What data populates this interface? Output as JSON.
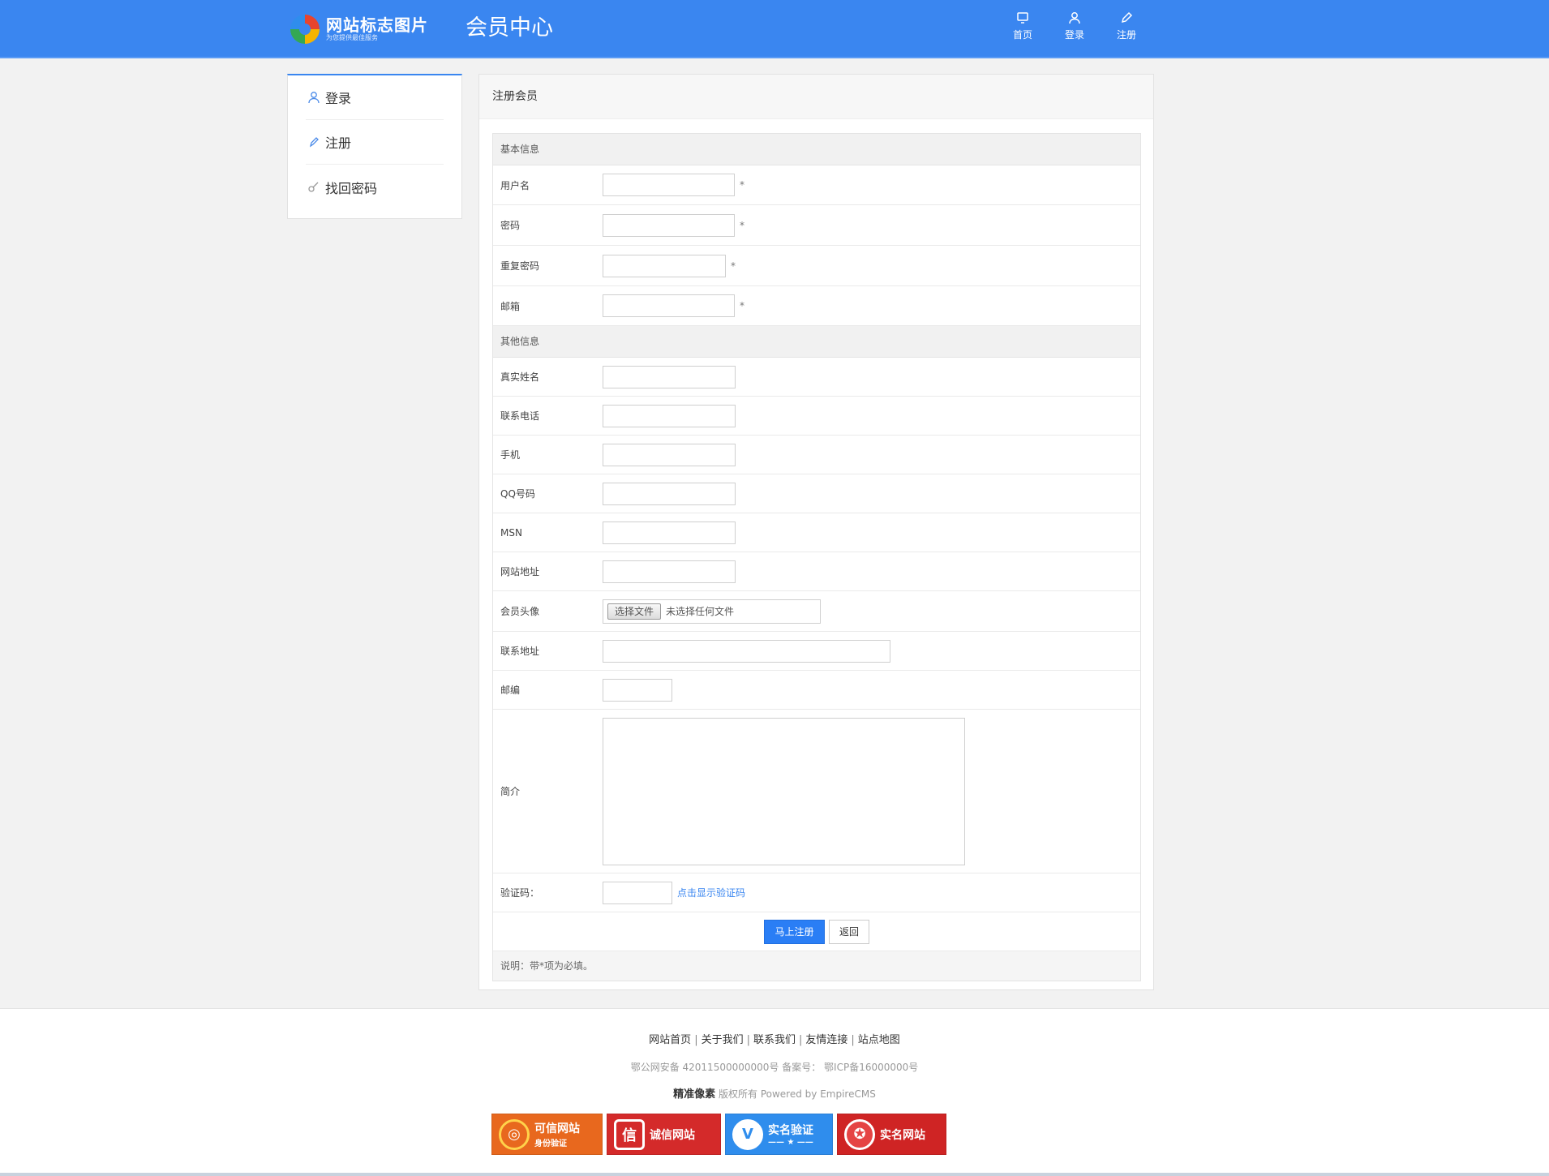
{
  "header": {
    "logo_main": "网站标志图片",
    "logo_sub": "为您提供最佳服务",
    "title": "会员中心",
    "nav": [
      {
        "label": "首页",
        "icon": "monitor-icon"
      },
      {
        "label": "登录",
        "icon": "user-icon"
      },
      {
        "label": "注册",
        "icon": "pencil-icon"
      }
    ]
  },
  "sidebar": {
    "items": [
      {
        "label": "登录",
        "icon": "user-icon"
      },
      {
        "label": "注册",
        "icon": "pencil-icon"
      },
      {
        "label": "找回密码",
        "icon": "key-icon"
      }
    ]
  },
  "panel": {
    "title": "注册会员",
    "basic_section": "基本信息",
    "other_section": "其他信息",
    "basic_fields": [
      {
        "label": "用户名",
        "required": "*"
      },
      {
        "label": "密码",
        "required": "*"
      },
      {
        "label": "重复密码",
        "required": "*"
      },
      {
        "label": "邮箱",
        "required": "*"
      }
    ],
    "other_fields": [
      {
        "label": "真实姓名"
      },
      {
        "label": "联系电话"
      },
      {
        "label": "手机"
      },
      {
        "label": "QQ号码"
      },
      {
        "label": "MSN"
      },
      {
        "label": "网站地址"
      }
    ],
    "avatar_label": "会员头像",
    "file_button": "选择文件",
    "file_status": "未选择任何文件",
    "address_label": "联系地址",
    "zip_label": "邮编",
    "intro_label": "简介",
    "captcha_label": "验证码：",
    "captcha_link": "点击显示验证码",
    "submit_button": "马上注册",
    "back_button": "返回",
    "note": "说明：带*项为必填。"
  },
  "footer": {
    "links": [
      "网站首页",
      "关于我们",
      "联系我们",
      "友情连接",
      "站点地图"
    ],
    "separator": "|",
    "icp": "鄂公网安备 42011500000000号 备案号： 鄂ICP备16000000号",
    "brand": "精准像素",
    "copyright": "版权所有 Powered by EmpireCMS",
    "badges": [
      {
        "label": "可信网站",
        "sub": "身份验证",
        "color": "#e8681e"
      },
      {
        "label": "诚信网站",
        "sub": "",
        "color": "#d42a2a"
      },
      {
        "label": "实名验证",
        "sub": "—— ★ ——",
        "color": "#2f8ded"
      },
      {
        "label": "实名网站",
        "sub": "",
        "color": "#cf2424"
      }
    ]
  }
}
